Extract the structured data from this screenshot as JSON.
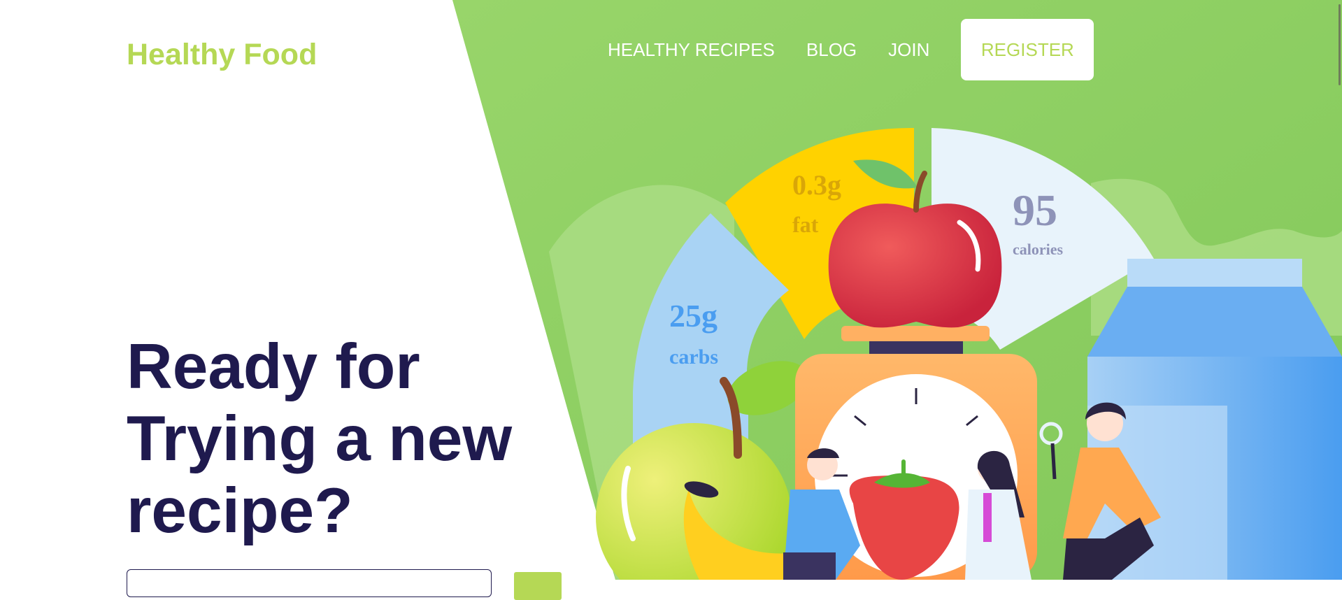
{
  "brand": {
    "name": "Healthy Food"
  },
  "nav": {
    "items": [
      {
        "label": "HEALTHY RECIPES"
      },
      {
        "label": "BLOG"
      },
      {
        "label": "JOIN"
      }
    ],
    "register_label": "REGISTER"
  },
  "hero": {
    "headline_lines": [
      "Ready for",
      "Trying a new",
      "recipe?"
    ]
  },
  "nutrition": {
    "fat": {
      "value": "0.3g",
      "label": "fat"
    },
    "calories": {
      "value": "95",
      "label": "calories"
    },
    "carbs": {
      "value": "25g",
      "label": "carbs"
    }
  },
  "colors": {
    "brand": "#b5d855",
    "headline": "#1f1a4e",
    "hero_green": "#8cce5f",
    "fat_yellow": "#ffd200",
    "carbs_blue": "#a9d3f4",
    "calories_pale": "#e8f3fb"
  }
}
